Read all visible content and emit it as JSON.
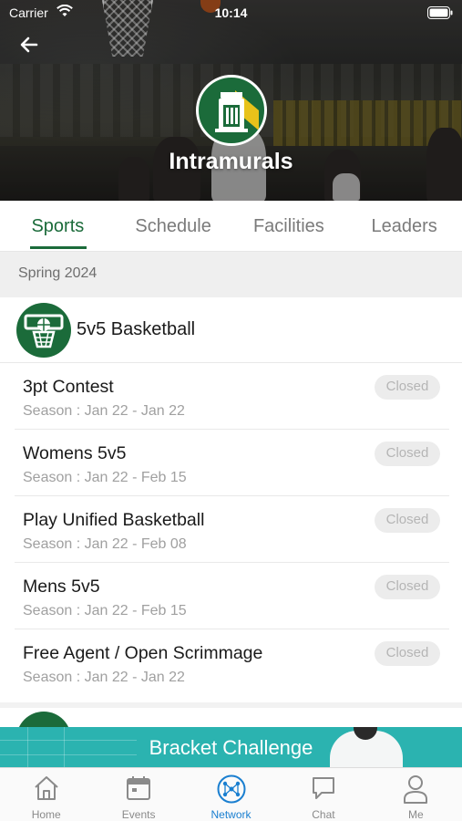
{
  "status_bar": {
    "carrier": "Carrier",
    "time": "10:14"
  },
  "header": {
    "title": "Intramurals"
  },
  "tabs": [
    {
      "label": "Sports",
      "active": true
    },
    {
      "label": "Schedule",
      "active": false
    },
    {
      "label": "Facilities",
      "active": false
    },
    {
      "label": "Leaders",
      "active": false
    }
  ],
  "season": {
    "label": "Spring 2024"
  },
  "sport": {
    "name": "5v5 Basketball"
  },
  "events": [
    {
      "name": "3pt Contest",
      "season": "Season : Jan 22 - Jan 22",
      "status": "Closed"
    },
    {
      "name": "Womens 5v5",
      "season": "Season : Jan 22 - Feb 15",
      "status": "Closed"
    },
    {
      "name": "Play Unified Basketball",
      "season": "Season : Jan 22 - Feb 08",
      "status": "Closed"
    },
    {
      "name": "Mens 5v5",
      "season": "Season : Jan 22 - Feb 15",
      "status": "Closed"
    },
    {
      "name": "Free Agent / Open Scrimmage",
      "season": "Season : Jan 22 - Jan 22",
      "status": "Closed"
    }
  ],
  "banner": {
    "title": "Bracket Challenge"
  },
  "bottom_nav": [
    {
      "label": "Home",
      "icon": "home-icon"
    },
    {
      "label": "Events",
      "icon": "calendar-icon"
    },
    {
      "label": "Network",
      "icon": "network-icon",
      "active": true
    },
    {
      "label": "Chat",
      "icon": "chat-icon"
    },
    {
      "label": "Me",
      "icon": "person-icon"
    }
  ],
  "colors": {
    "brand_green": "#1b6b3a",
    "active_blue": "#1a7fd0",
    "banner_teal": "#2bb3b0"
  }
}
